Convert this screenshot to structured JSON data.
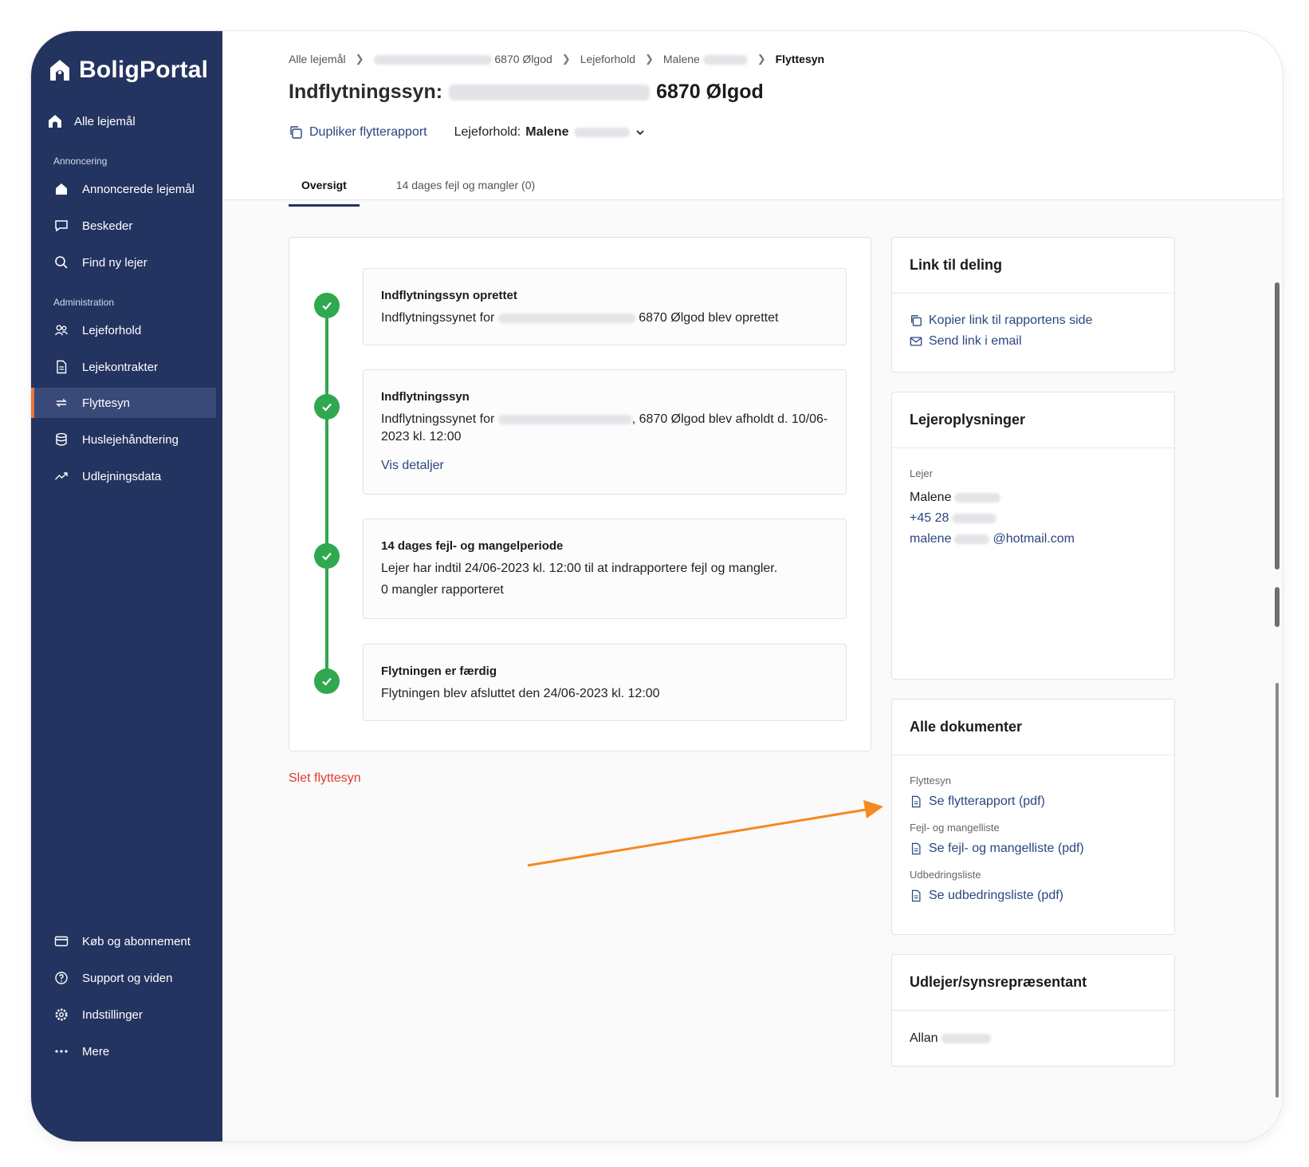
{
  "brand": {
    "name": "BoligPortal"
  },
  "sidebar": {
    "top_item": {
      "label": "Alle lejemål",
      "icon": "house-icon"
    },
    "section_annoncering": "Annoncering",
    "annoncering_items": [
      {
        "label": "Annoncerede lejemål",
        "icon": "megaphone-house-icon"
      },
      {
        "label": "Beskeder",
        "icon": "chat-icon"
      },
      {
        "label": "Find ny lejer",
        "icon": "search-icon"
      }
    ],
    "section_administration": "Administration",
    "administration_items": [
      {
        "label": "Lejeforhold",
        "icon": "people-icon"
      },
      {
        "label": "Lejekontrakter",
        "icon": "document-icon"
      },
      {
        "label": "Flyttesyn",
        "icon": "arrows-icon",
        "active": true
      },
      {
        "label": "Huslejehåndtering",
        "icon": "database-icon"
      },
      {
        "label": "Udlejningsdata",
        "icon": "trend-icon"
      }
    ],
    "bottom_items": [
      {
        "label": "Køb og abonnement",
        "icon": "credit-card-icon"
      },
      {
        "label": "Support og viden",
        "icon": "help-icon"
      },
      {
        "label": "Indstillinger",
        "icon": "gear-icon"
      },
      {
        "label": "Mere",
        "icon": "more-icon"
      }
    ]
  },
  "breadcrumb": {
    "items": [
      "Alle lejemål",
      "6870 Ølgod",
      "Lejeforhold",
      "Malene"
    ],
    "current": "Flyttesyn"
  },
  "header": {
    "title_prefix": "Indflytningssyn:",
    "title_city": "6870 Ølgod",
    "duplicate_label": "Dupliker flytterapport",
    "lejeforhold_label": "Lejeforhold:",
    "lejeforhold_value": "Malene"
  },
  "tabs": [
    {
      "label": "Oversigt",
      "active": true
    },
    {
      "label": "14 dages fejl og mangler (0)",
      "active": false
    }
  ],
  "timeline": [
    {
      "title": "Indflytningssyn oprettet",
      "text_prefix": "Indflytningssynet for",
      "text_suffix": "6870 Ølgod blev oprettet"
    },
    {
      "title": "Indflytningssyn",
      "text_prefix": "Indflytningssynet for",
      "text_suffix": ", 6870 Ølgod blev afholdt d. 10/06-",
      "text_line2": "2023 kl. 12:00",
      "link": "Vis detaljer"
    },
    {
      "title": "14 dages fejl- og mangelperiode",
      "text": "Lejer har indtil 24/06-2023 kl. 12:00 til at indrapportere fejl og mangler.",
      "extra": "0 mangler rapporteret"
    },
    {
      "title": "Flytningen er færdig",
      "text": "Flytningen blev afsluttet den 24/06-2023 kl. 12:00"
    }
  ],
  "delete_label": "Slet flyttesyn",
  "share_card": {
    "title": "Link til deling",
    "copy_link": "Kopier link til rapportens side",
    "send_email": "Send link i email"
  },
  "tenant_card": {
    "title": "Lejeroplysninger",
    "label": "Lejer",
    "name": "Malene",
    "phone": "+45 28",
    "email_prefix": "malene",
    "email_suffix": "@hotmail.com"
  },
  "documents_card": {
    "title": "Alle dokumenter",
    "groups": [
      {
        "label": "Flyttesyn",
        "link": "Se flytterapport (pdf)"
      },
      {
        "label": "Fejl- og mangelliste",
        "link": "Se fejl- og mangelliste (pdf)"
      },
      {
        "label": "Udbedringsliste",
        "link": "Se udbedringsliste (pdf)"
      }
    ]
  },
  "landlord_card": {
    "title": "Udlejer/synsrepræsentant",
    "name": "Allan"
  },
  "colors": {
    "sidebar_bg": "#243460",
    "accent_orange": "#f5891f",
    "success_green": "#2fa84f",
    "link_blue": "#2a4680",
    "danger_red": "#e03b2f"
  }
}
